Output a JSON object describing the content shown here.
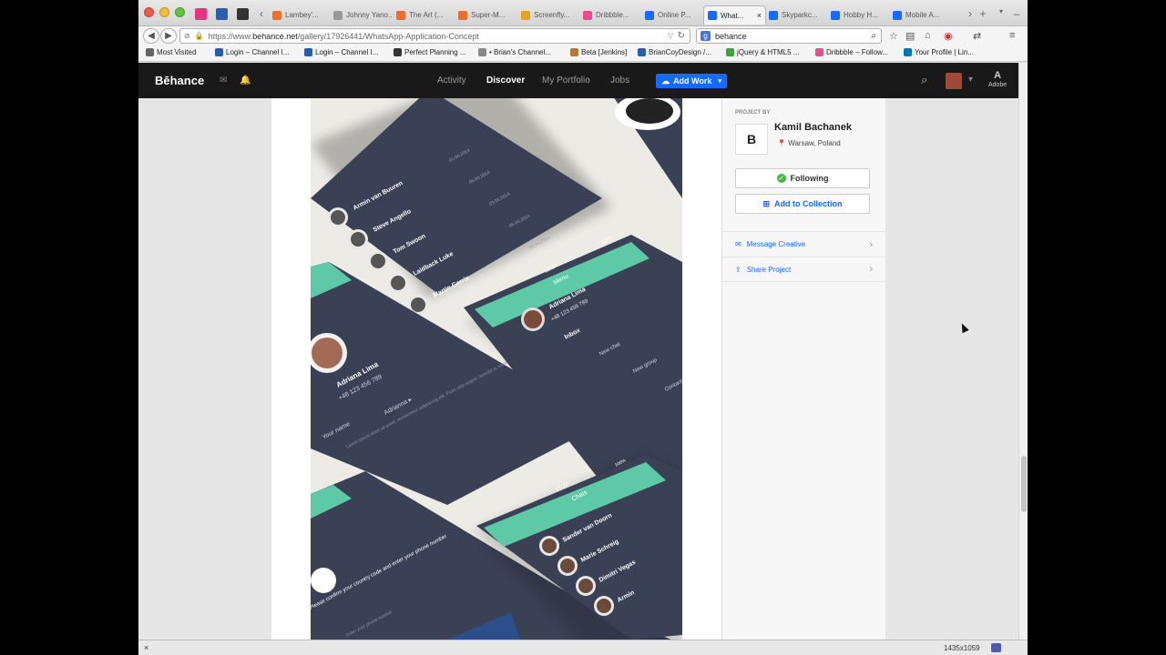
{
  "browser": {
    "tabs": [
      {
        "label": "Lambey'...",
        "color": "#e8702a"
      },
      {
        "label": "Johnny Yano...",
        "color": "#999999"
      },
      {
        "label": "The Art (...",
        "color": "#e8702a"
      },
      {
        "label": "Super-M...",
        "color": "#e8702a"
      },
      {
        "label": "Screenfly...",
        "color": "#e8a020"
      },
      {
        "label": "Dribbble...",
        "color": "#ea4c89"
      },
      {
        "label": "Online P...",
        "color": "#1769ff"
      },
      {
        "label": "What...",
        "color": "#1769ff",
        "active": true
      },
      {
        "label": "Skyparkc...",
        "color": "#1769ff"
      },
      {
        "label": "Hobby H...",
        "color": "#1769ff"
      },
      {
        "label": "Mobile A...",
        "color": "#1769ff"
      }
    ],
    "url": {
      "prefix": "https://www.",
      "domain": "behance.net",
      "path": "/gallery/17926441/WhatsApp-Application-Concept"
    },
    "search_value": "behance",
    "bookmarks": [
      {
        "label": "Most Visited",
        "color": "#666666"
      },
      {
        "label": "Login – Channel I...",
        "color": "#2a5db0"
      },
      {
        "label": "Login – Channel I...",
        "color": "#2a5db0"
      },
      {
        "label": "Perfect Planning ...",
        "color": "#333333"
      },
      {
        "label": "• Brian's Channel...",
        "color": "#888888"
      },
      {
        "label": "Beta [Jenkins]",
        "color": "#b07a3a"
      },
      {
        "label": "BrianCoyDesign /...",
        "color": "#2a5db0"
      },
      {
        "label": "jQuery & HTML5 ...",
        "color": "#3aa53a"
      },
      {
        "label": "Dribbble – Follow...",
        "color": "#ea4c89"
      },
      {
        "label": "Your Profile | Lin...",
        "color": "#0077b5"
      }
    ],
    "status_dimensions": "1435x1059"
  },
  "behance": {
    "logo": "Bēhance",
    "nav": [
      {
        "label": "Activity",
        "active": false
      },
      {
        "label": "Discover",
        "active": true
      },
      {
        "label": "My Portfolio",
        "active": false
      },
      {
        "label": "Jobs",
        "active": false
      }
    ],
    "add_work": "Add Work",
    "adobe": "Adobe",
    "brand_color": "#1769ff"
  },
  "sidebar": {
    "project_by": "PROJECT BY",
    "owner_name": "Kamil Bachanek",
    "owner_location": "Warsaw, Poland",
    "owner_logo": "B",
    "following": "Following",
    "add_to_collection": "Add to Collection",
    "message_creative": "Message Creative",
    "share_project": "Share Project"
  },
  "artwork": {
    "accent": "#5ec9a6",
    "panel": "#3a4154",
    "dates": [
      "01.06.2014",
      "06.06.2014",
      "03.06.2014",
      "05.06.2014",
      "05.06.2014"
    ],
    "contacts": [
      "Armin van Buuren",
      "Steve Angello",
      "Tom Swoon",
      "Laidback Luke",
      "Martin Garrix"
    ],
    "menu_title": "Menu",
    "menu_name": "Adriana Lima",
    "menu_phone": "+48 123 456 789",
    "menu_items": [
      "Inbox",
      "New chat",
      "New group",
      "Contacts"
    ],
    "time": "15:24",
    "battery": "100%",
    "profile_name": "Adriana Lima",
    "profile_phone": "+48 123 456 789",
    "profile_status": "Adrianna ▸",
    "your_name": "Your name",
    "lorem": "Lorem ipsum dolor sit amet, consectetur adipisicing elit. Proin nibh augue, suscipit a, scelerisque",
    "chats_title": "Chats",
    "chat_list": [
      "Sander van Doorn",
      "Marie Schreig",
      "Dimitri Vegas",
      "Armin"
    ],
    "confirm_text": "Please confirm your country code and enter your phone number",
    "phone_placeholder": "Enter your phone number"
  }
}
